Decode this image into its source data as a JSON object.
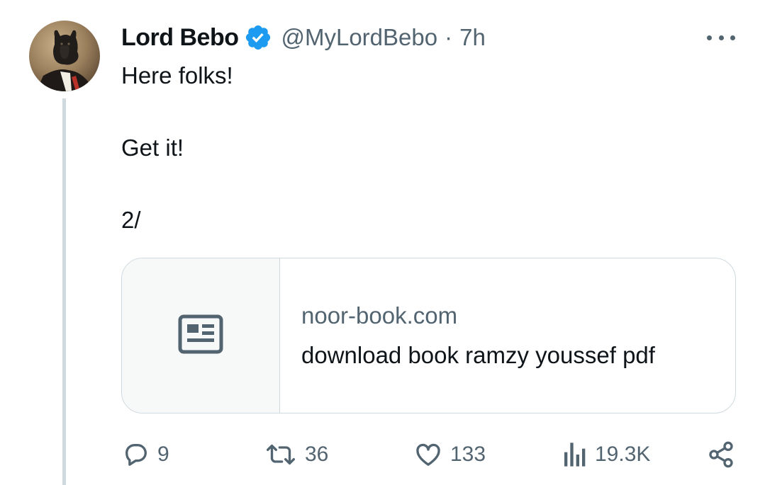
{
  "author": {
    "name": "Lord Bebo",
    "handle": "@MyLordBebo",
    "separator": "·",
    "time": "7h",
    "verified": true
  },
  "tweet": {
    "lines": [
      "Here folks!",
      "Get it!",
      "2/"
    ]
  },
  "link_card": {
    "domain": "noor-book.com",
    "title": "download book ramzy youssef pdf",
    "thumbnail_icon": "article-icon"
  },
  "actions": {
    "reply_count": "9",
    "retweet_count": "36",
    "like_count": "133",
    "views_count": "19.3K"
  },
  "colors": {
    "verified_blue": "#1d9bf0",
    "text_primary": "#0f1419",
    "text_secondary": "#536471",
    "border": "#cfd9de"
  }
}
